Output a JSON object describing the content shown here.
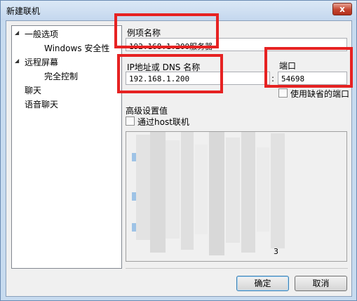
{
  "window": {
    "title": "新建联机",
    "close_label": "x"
  },
  "tree": {
    "items": [
      {
        "label": "一般选项",
        "expanded": true
      },
      {
        "label": "Windows 安全性"
      },
      {
        "label": "远程屏幕",
        "expanded": true
      },
      {
        "label": "完全控制"
      },
      {
        "label": "聊天"
      },
      {
        "label": "语音聊天"
      }
    ]
  },
  "form": {
    "instance_name_label": "例项名称",
    "instance_name_value": "192.168.1.200服务器",
    "host_label": "IP地址或 DNS 名称",
    "host_value": "192.168.1.200",
    "port_separator": ":",
    "port_label": "端口",
    "port_value": "54698",
    "default_port_label": "使用缺省的端口",
    "advanced_label": "高级设置值",
    "via_host_label": "通过host联机",
    "blurred_tail": "3"
  },
  "buttons": {
    "ok": "确定",
    "cancel": "取消"
  },
  "colors": {
    "highlight_box": "#e62222",
    "title_bg": "#c4d7ee",
    "close_button": "#c4452f"
  }
}
